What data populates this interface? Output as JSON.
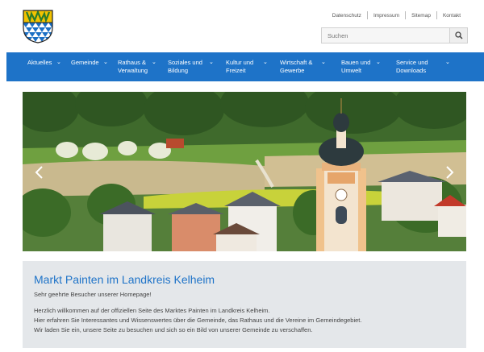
{
  "header": {
    "utility_links": [
      "Datenschutz",
      "Impressum",
      "Sitemap",
      "Kontakt"
    ],
    "search": {
      "placeholder": "Suchen"
    }
  },
  "nav": {
    "items": [
      {
        "label": "Aktuelles",
        "label2": ""
      },
      {
        "label": "Gemeinde",
        "label2": ""
      },
      {
        "label": "Rathaus &",
        "label2": "Verwaltung"
      },
      {
        "label": "Soziales und",
        "label2": "Bildung"
      },
      {
        "label": "Kultur und",
        "label2": "Freizeit"
      },
      {
        "label": "Wirtschaft &",
        "label2": "Gewerbe"
      },
      {
        "label": "Bauen und",
        "label2": "Umwelt"
      },
      {
        "label": "Service und",
        "label2": "Downloads"
      }
    ]
  },
  "welcome": {
    "title": "Markt Painten im Landkreis Kelheim",
    "subtitle": "Sehr geehrte Besucher unserer Homepage!",
    "lines": [
      "Herzlich willkommen auf der offiziellen Seite des Marktes Painten im Landkreis Kelheim.",
      "Hier erfahren Sie Interessantes und Wissenswertes über die Gemeinde, das Rathaus und die Vereine im Gemeindegebiet.",
      "Wir laden Sie ein, unsere Seite zu besuchen und sich so ein Bild von unserer Gemeinde zu verschaffen."
    ]
  },
  "colors": {
    "brand_blue": "#1e73c8",
    "panel_gray": "#e4e7ea"
  },
  "icons": {
    "search": "search-icon",
    "prev": "chevron-left-icon",
    "next": "chevron-right-icon"
  }
}
